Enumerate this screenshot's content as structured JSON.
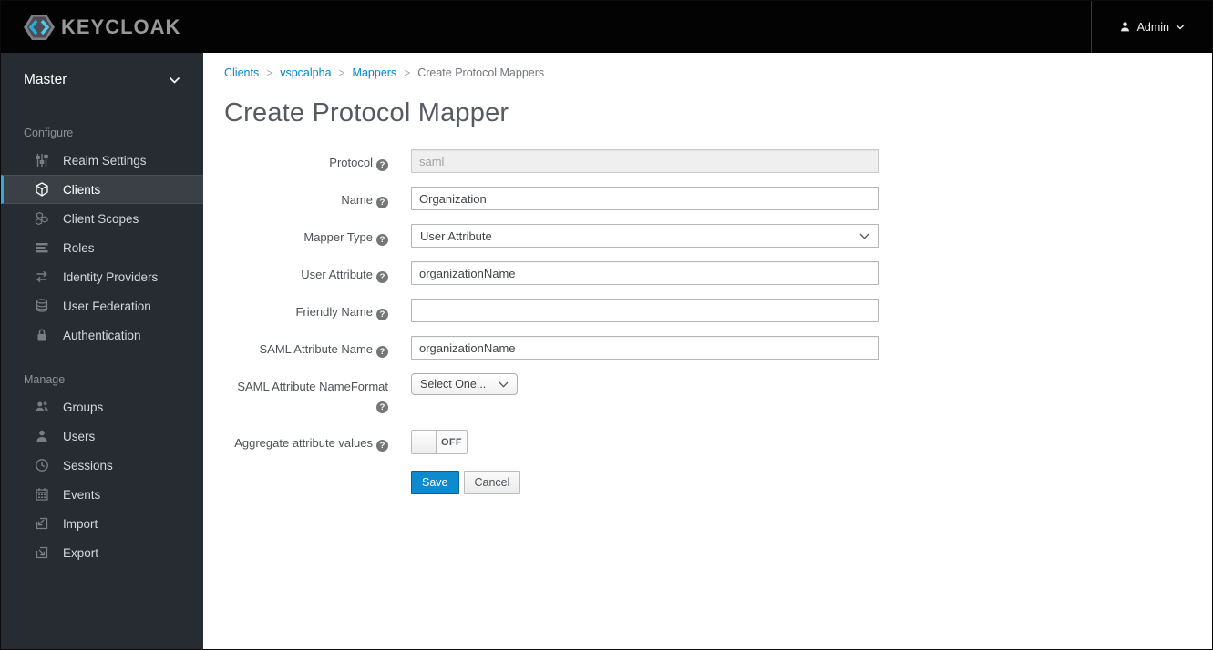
{
  "topbar": {
    "brand": "KEYCLOAK",
    "user_label": "Admin"
  },
  "sidebar": {
    "realm": "Master",
    "sections": [
      {
        "header": "Configure",
        "items": [
          {
            "label": "Realm Settings"
          },
          {
            "label": "Clients",
            "active": true
          },
          {
            "label": "Client Scopes"
          },
          {
            "label": "Roles"
          },
          {
            "label": "Identity Providers"
          },
          {
            "label": "User Federation"
          },
          {
            "label": "Authentication"
          }
        ]
      },
      {
        "header": "Manage",
        "items": [
          {
            "label": "Groups"
          },
          {
            "label": "Users"
          },
          {
            "label": "Sessions"
          },
          {
            "label": "Events"
          },
          {
            "label": "Import"
          },
          {
            "label": "Export"
          }
        ]
      }
    ]
  },
  "breadcrumb": {
    "separator": ">",
    "items": [
      {
        "label": "Clients"
      },
      {
        "label": "vspcalpha"
      },
      {
        "label": "Mappers"
      },
      {
        "label": "Create Protocol Mappers"
      }
    ]
  },
  "page": {
    "title": "Create Protocol Mapper"
  },
  "form": {
    "help_glyph": "?",
    "fields": [
      {
        "label": "Protocol",
        "type": "text",
        "value": "saml",
        "disabled": true
      },
      {
        "label": "Name",
        "type": "text",
        "value": "Organization"
      },
      {
        "label": "Mapper Type",
        "type": "select",
        "value": "User Attribute"
      },
      {
        "label": "User Attribute",
        "type": "text",
        "value": "organizationName"
      },
      {
        "label": "Friendly Name",
        "type": "text",
        "value": ""
      },
      {
        "label": "SAML Attribute Name",
        "type": "text",
        "value": "organizationName"
      },
      {
        "label": "SAML Attribute NameFormat",
        "type": "select-small",
        "value": "Select One..."
      },
      {
        "label": "Aggregate attribute values",
        "type": "toggle",
        "value": "OFF"
      }
    ],
    "buttons": {
      "save": "Save",
      "cancel": "Cancel"
    }
  },
  "colors": {
    "accent": "#0088ce",
    "active_border": "#39a5dc",
    "topbar_bg": "#030303",
    "sidebar_bg": "#272c32"
  }
}
